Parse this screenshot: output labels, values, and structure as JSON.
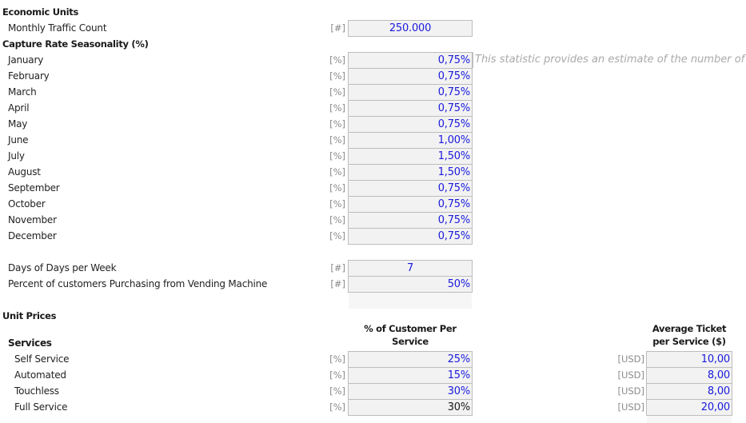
{
  "economic_units": {
    "title": "Economic Units",
    "monthly_traffic": {
      "label": "Monthly Traffic Count",
      "unit": "[#]",
      "value": "250.000"
    }
  },
  "seasonality": {
    "title": "Capture Rate Seasonality (%)",
    "note": "This statistic provides an estimate of the number of ve",
    "months": [
      {
        "label": "January",
        "unit": "[%]",
        "value": "0,75%"
      },
      {
        "label": "February",
        "unit": "[%]",
        "value": "0,75%"
      },
      {
        "label": "March",
        "unit": "[%]",
        "value": "0,75%"
      },
      {
        "label": "April",
        "unit": "[%]",
        "value": "0,75%"
      },
      {
        "label": "May",
        "unit": "[%]",
        "value": "0,75%"
      },
      {
        "label": "June",
        "unit": "[%]",
        "value": "1,00%"
      },
      {
        "label": "July",
        "unit": "[%]",
        "value": "1,50%"
      },
      {
        "label": "August",
        "unit": "[%]",
        "value": "1,50%"
      },
      {
        "label": "September",
        "unit": "[%]",
        "value": "0,75%"
      },
      {
        "label": "October",
        "unit": "[%]",
        "value": "0,75%"
      },
      {
        "label": "November",
        "unit": "[%]",
        "value": "0,75%"
      },
      {
        "label": "December",
        "unit": "[%]",
        "value": "0,75%"
      }
    ]
  },
  "other": {
    "days_per_week": {
      "label": "Days of Days per Week",
      "unit": "[#]",
      "value": "7"
    },
    "vending_pct": {
      "label": "Percent of customers Purchasing from Vending Machine",
      "unit": "[#]",
      "value": "50%"
    }
  },
  "unit_prices": {
    "title": "Unit Prices",
    "services_header": "Services",
    "pct_header_line1": "% of Customer Per",
    "pct_header_line2": "Service",
    "ticket_header_line1": "Average Ticket",
    "ticket_header_line2": "per Service ($)",
    "services": [
      {
        "label": "Self Service",
        "pct_unit": "[%]",
        "pct": "25%",
        "ticket_unit": "[USD]",
        "ticket": "10,00"
      },
      {
        "label": "Automated",
        "pct_unit": "[%]",
        "pct": "15%",
        "ticket_unit": "[USD]",
        "ticket": "8,00"
      },
      {
        "label": "Touchless",
        "pct_unit": "[%]",
        "pct": "30%",
        "ticket_unit": "[USD]",
        "ticket": "8,00"
      },
      {
        "label": "Full Service",
        "pct_unit": "[%]",
        "pct": "30%",
        "ticket_unit": "[USD]",
        "ticket": "20,00"
      }
    ]
  },
  "colors": {
    "input_text": "#1a1adc",
    "input_bg": "#f2f2f2",
    "border": "#bdbdbd"
  }
}
